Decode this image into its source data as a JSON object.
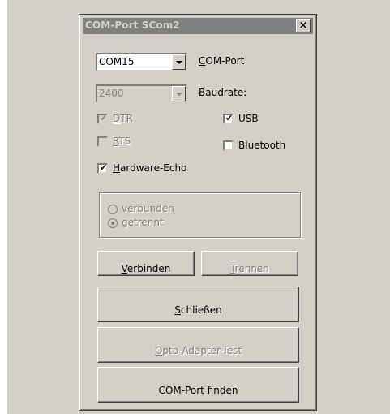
{
  "window": {
    "title": "COM-Port SCom2",
    "close_label": "×"
  },
  "port": {
    "value": "COM15",
    "label_u": "C",
    "label_rest": "OM-Port"
  },
  "baud": {
    "value": "2400",
    "label_u": "B",
    "label_rest": "audrate:"
  },
  "checks": {
    "dtr": {
      "u": "D",
      "rest": "TR",
      "checked": true,
      "enabled": false
    },
    "rts": {
      "u": "R",
      "rest": "TS",
      "checked": false,
      "enabled": false
    },
    "usb": {
      "label": "USB",
      "checked": true
    },
    "bluetooth": {
      "label": "Bluetooth",
      "checked": false
    },
    "echo": {
      "u": "H",
      "rest": "ardware-Echo",
      "checked": true
    }
  },
  "status": {
    "connected": "verbunden",
    "disconnected": "getrennt",
    "selected": "disconnected"
  },
  "buttons": {
    "connect": {
      "u": "V",
      "rest": "erbinden"
    },
    "disconnect": {
      "u": "T",
      "rest": "rennen"
    },
    "close": {
      "u": "S",
      "rest": "chließen"
    },
    "opto": {
      "u": "O",
      "rest": "pto-Adapter-Test"
    },
    "find": {
      "u": "C",
      "rest": "OM-Port finden"
    }
  },
  "check_glyph": "✔"
}
